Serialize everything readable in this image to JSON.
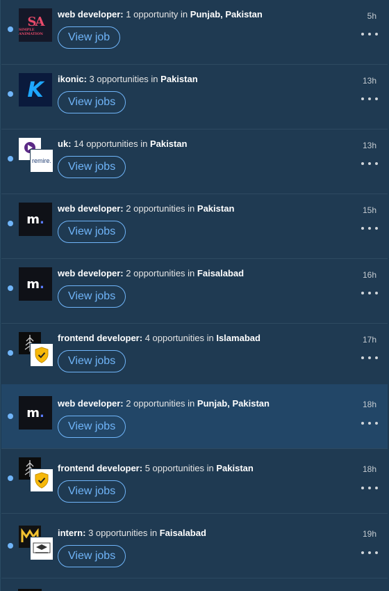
{
  "items": [
    {
      "role": "web developer:",
      "count": "1 opportunity in",
      "place": "Punjab, Pakistan",
      "time": "5h",
      "button": "View job",
      "logo": "sa-logo",
      "logo_text": "SA",
      "logo_sub": "SIMPLE ANIMATION"
    },
    {
      "role": "ikonic:",
      "count": "3 opportunities in",
      "place": "Pakistan",
      "time": "13h",
      "button": "View jobs",
      "logo": "k-logo",
      "logo_text": "K"
    },
    {
      "role": "uk:",
      "count": "14 opportunities in",
      "place": "Pakistan",
      "time": "13h",
      "button": "View jobs",
      "logo": "uk-logo",
      "badge_text": "remire."
    },
    {
      "role": "web developer:",
      "count": "2 opportunities in",
      "place": "Pakistan",
      "time": "15h",
      "button": "View jobs",
      "logo": "m-logo"
    },
    {
      "role": "web developer:",
      "count": "2 opportunities in",
      "place": "Faisalabad",
      "time": "16h",
      "button": "View jobs",
      "logo": "m-logo"
    },
    {
      "role": "frontend developer:",
      "count": "4 opportunities in",
      "place": "Islamabad",
      "time": "17h",
      "button": "View jobs",
      "logo": "tree-shield-logo"
    },
    {
      "role": "web developer:",
      "count": "2 opportunities in",
      "place": "Punjab, Pakistan",
      "time": "18h",
      "button": "View jobs",
      "logo": "m-logo"
    },
    {
      "role": "frontend developer:",
      "count": "5 opportunities in",
      "place": "Pakistan",
      "time": "18h",
      "button": "View jobs",
      "logo": "tree-shield-logo"
    },
    {
      "role": "intern:",
      "count": "3 opportunities in",
      "place": "Faisalabad",
      "time": "19h",
      "button": "View jobs",
      "logo": "mj-logo"
    }
  ],
  "colors": {
    "accent": "#70b5f9",
    "unread_dot": "#70b5f9",
    "background": "#1f3a52",
    "highlight": "#224667"
  }
}
